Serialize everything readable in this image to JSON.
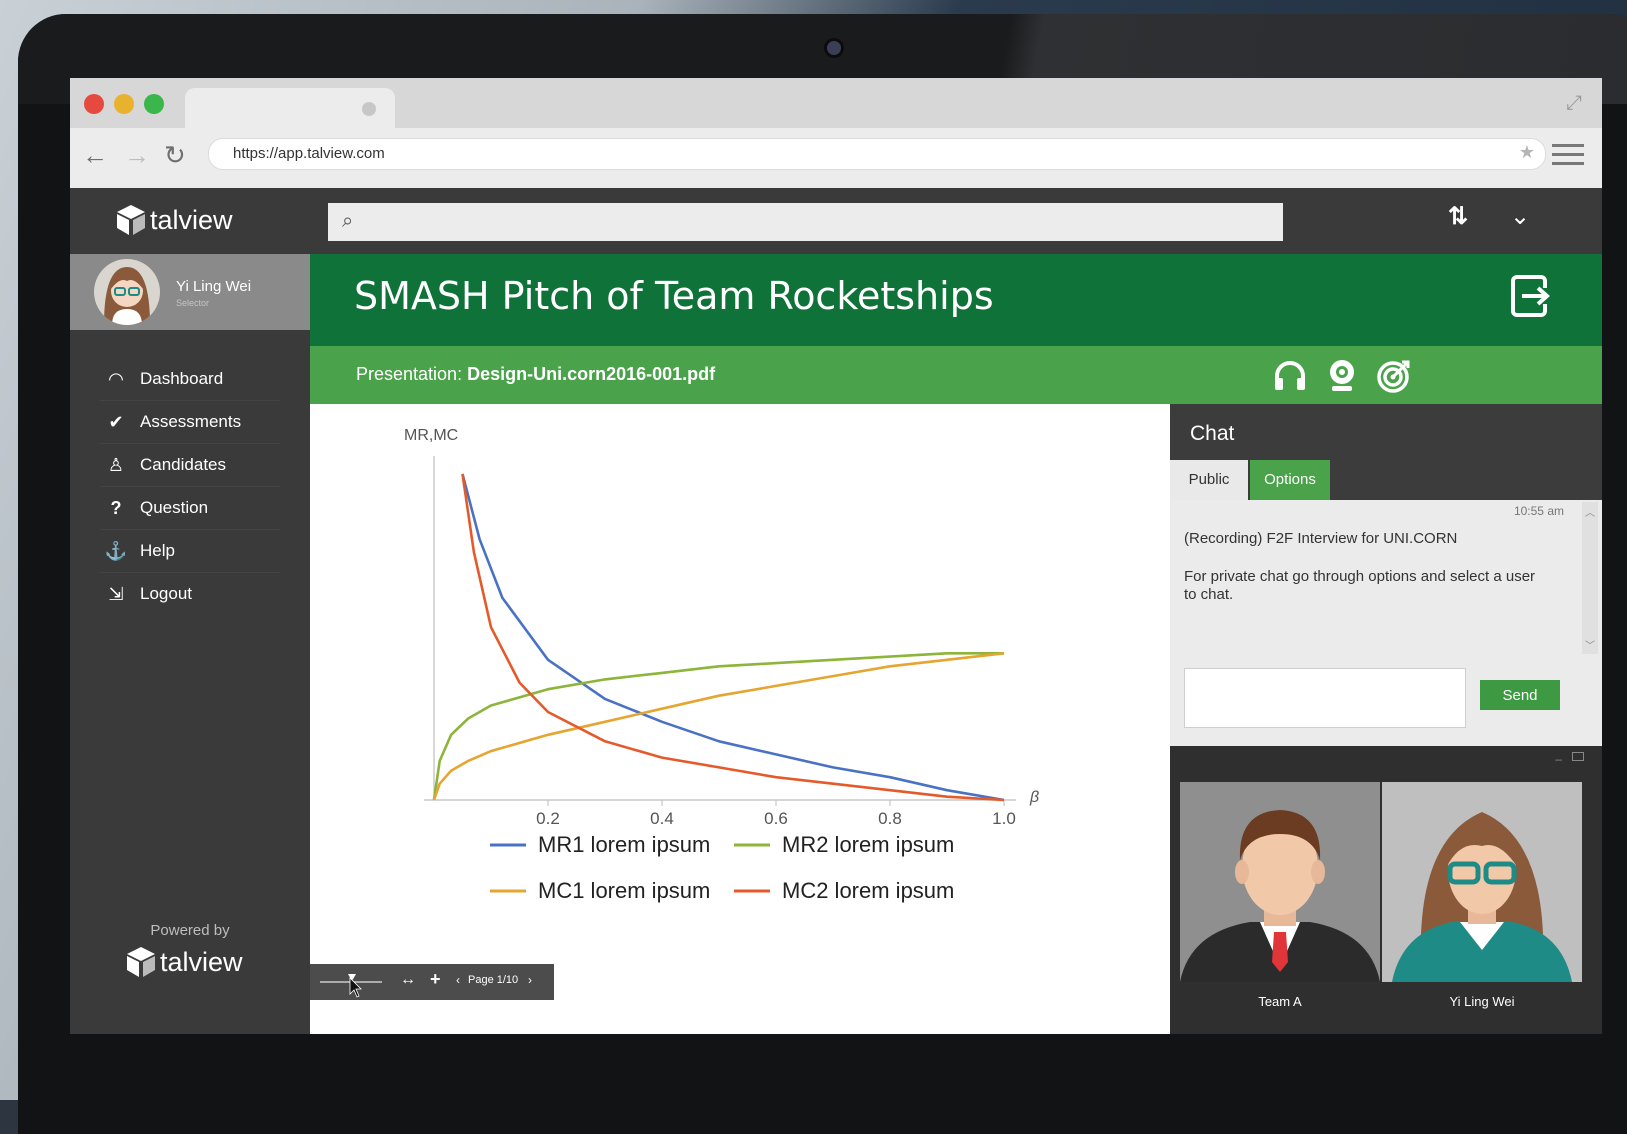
{
  "browser": {
    "url": "https://app.talview.com"
  },
  "app": {
    "logo_text": "talview",
    "search_placeholder": ""
  },
  "user": {
    "name": "Yi Ling Wei",
    "role": "Selector"
  },
  "nav": [
    {
      "label": "Dashboard",
      "icon": "gauge-icon"
    },
    {
      "label": "Assessments",
      "icon": "check-icon"
    },
    {
      "label": "Candidates",
      "icon": "users-icon"
    },
    {
      "label": "Question",
      "icon": "question-icon"
    },
    {
      "label": "Help",
      "icon": "anchor-icon"
    },
    {
      "label": "Logout",
      "icon": "logout-icon"
    }
  ],
  "footer": {
    "powered_by": "Powered by",
    "logo_text": "talview"
  },
  "session": {
    "title": "SMASH Pitch of Team Rocketships",
    "presentation_label": "Presentation:",
    "presentation_file": "Design-Uni.corn2016-001.pdf"
  },
  "viewer": {
    "page_label": "Page 1/10"
  },
  "chat": {
    "title": "Chat",
    "tabs": [
      "Public",
      "Options"
    ],
    "active_tab": "Options",
    "time": "10:55 am",
    "messages": [
      "(Recording) F2F Interview for UNI.CORN",
      "For private chat go through options and select a user to chat."
    ],
    "send_label": "Send"
  },
  "participants": [
    {
      "name": "Team A"
    },
    {
      "name": "Yi Ling Wei"
    }
  ],
  "colors": {
    "dark_green": "#0f7238",
    "light_green": "#4aa34b",
    "sidebar": "#3a3a3a",
    "mr1": "#4a72c4",
    "mr2": "#8db53a",
    "mc1": "#e5a530",
    "mc2": "#e55a2b"
  },
  "chart_data": {
    "type": "line",
    "ylabel": "MR,MC",
    "xlabel": "β",
    "xlim": [
      0,
      1.0
    ],
    "ylim": [
      0,
      1.0
    ],
    "xticks": [
      "0.2",
      "0.4",
      "0.6",
      "0.8",
      "1.0"
    ],
    "series": [
      {
        "name": "MR1 lorem ipsum",
        "color": "#4a72c4",
        "x": [
          0.05,
          0.08,
          0.12,
          0.2,
          0.3,
          0.4,
          0.5,
          0.6,
          0.7,
          0.8,
          0.9,
          1.0
        ],
        "y": [
          1.0,
          0.8,
          0.62,
          0.43,
          0.31,
          0.24,
          0.18,
          0.14,
          0.1,
          0.07,
          0.03,
          0.0
        ]
      },
      {
        "name": "MR2 lorem ipsum",
        "color": "#8db53a",
        "x": [
          0.0,
          0.01,
          0.03,
          0.06,
          0.1,
          0.2,
          0.3,
          0.4,
          0.5,
          0.6,
          0.7,
          0.8,
          0.9,
          1.0
        ],
        "y": [
          0.0,
          0.12,
          0.2,
          0.25,
          0.29,
          0.34,
          0.37,
          0.39,
          0.41,
          0.42,
          0.43,
          0.44,
          0.45,
          0.45
        ]
      },
      {
        "name": "MC1 lorem ipsum",
        "color": "#e5a530",
        "x": [
          0.0,
          0.01,
          0.03,
          0.06,
          0.1,
          0.2,
          0.3,
          0.4,
          0.5,
          0.6,
          0.7,
          0.8,
          0.9,
          1.0
        ],
        "y": [
          0.0,
          0.05,
          0.09,
          0.12,
          0.15,
          0.2,
          0.24,
          0.28,
          0.32,
          0.35,
          0.38,
          0.41,
          0.43,
          0.45
        ]
      },
      {
        "name": "MC2 lorem ipsum",
        "color": "#e55a2b",
        "x": [
          0.05,
          0.07,
          0.1,
          0.15,
          0.2,
          0.3,
          0.4,
          0.5,
          0.6,
          0.7,
          0.8,
          0.9,
          1.0
        ],
        "y": [
          1.0,
          0.76,
          0.53,
          0.36,
          0.27,
          0.18,
          0.13,
          0.1,
          0.07,
          0.05,
          0.03,
          0.01,
          0.0
        ]
      }
    ]
  }
}
